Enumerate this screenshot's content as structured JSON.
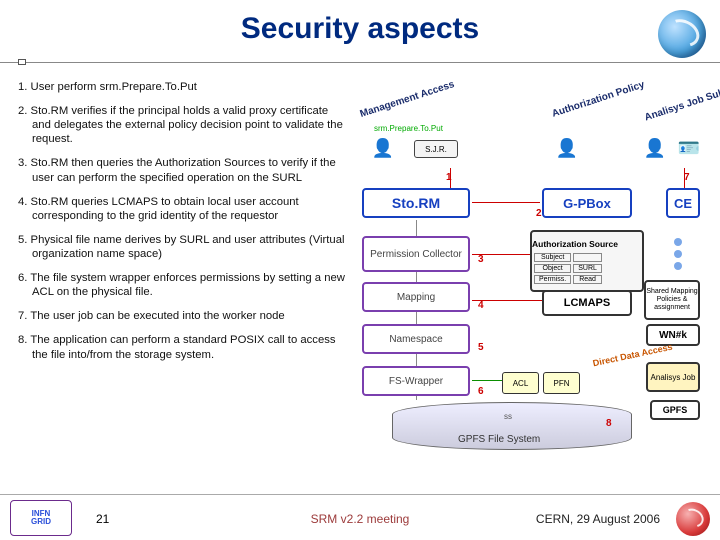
{
  "title": "Security aspects",
  "steps": [
    "1. User perform srm.Prepare.To.Put",
    "2. Sto.RM verifies if the principal holds a valid proxy certificate and delegates the external policy decision point to validate the request.",
    "3. Sto.RM then queries the Authorization Sources to verify if the user can perform the specified operation on the SURL",
    "4. Sto.RM queries LCMAPS to obtain local user account corresponding to the grid identity of the requestor",
    "5. Physical file name derives by SURL and user attributes (Virtual organization name space)",
    "6. The file system wrapper enforces permissions by setting a new ACL on the physical file.",
    "7. The user job can be executed into the worker node",
    "8. The application can perform a standard POSIX call to access the file into/from the storage system."
  ],
  "diagram": {
    "col_headers": [
      "Management Access",
      "Authorization Policy",
      "Analisys Job Submission"
    ],
    "prepare_label": "srm.Prepare.To.Put",
    "actor_sjr": "S.J.R.",
    "boxes": {
      "storm": "Sto.RM",
      "gpbox": "G-PBox",
      "ce": "CE",
      "perm": "Permission Collector",
      "mapping": "Mapping",
      "ns": "Namespace",
      "fsw": "FS-Wrapper",
      "lcmaps": "LCMAPS",
      "smp": "Shared Mapping Policies & assignment",
      "wnk": "WN#k",
      "anjob": "Analisys Job",
      "gpfs": "GPFS",
      "authsrc_title": "Authorization Source",
      "authsrc_rows": [
        [
          "Subject",
          ""
        ],
        [
          "Object",
          "SURL"
        ],
        [
          "Permiss.",
          "Read"
        ]
      ],
      "acl": "ACL",
      "pfn": "PFN",
      "ss": "ss"
    },
    "dda": "Direct Data Access",
    "gpfs_fs": "GPFS File System",
    "step_numbers": [
      "1",
      "2",
      "3",
      "4",
      "5",
      "6",
      "7",
      "8"
    ]
  },
  "footer": {
    "logo_top": "INFN",
    "logo_bottom": "GRID",
    "page": "21",
    "center": "SRM v2.2 meeting",
    "right": "CERN, 29 August 2006"
  }
}
